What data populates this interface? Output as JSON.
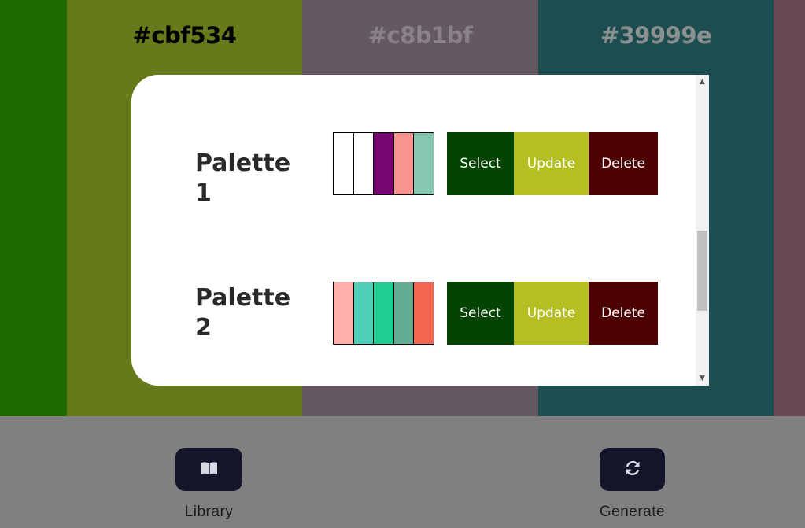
{
  "columns": [
    {
      "color": "#1e6800",
      "hex": "",
      "text_color": "#000000"
    },
    {
      "color": "#667a1b",
      "hex": "#cbf534",
      "text_color": "#000000"
    },
    {
      "color": "#645861",
      "hex": "#c8b1bf",
      "text_color": "#8a8289"
    },
    {
      "color": "#1d4d50",
      "hex": "#39999e",
      "text_color": "#8a8f8f"
    },
    {
      "color": "#674a53",
      "hex": "",
      "text_color": "#000000"
    }
  ],
  "modal": {
    "palettes": [
      {
        "name": "Palette 1",
        "swatches": [
          "#ffffff",
          "#ffffff",
          "#76066f",
          "#f8938e",
          "#85c7b1"
        ],
        "select_label": "Select",
        "update_label": "Update",
        "delete_label": "Delete"
      },
      {
        "name": "Palette 2",
        "swatches": [
          "#ffafaa",
          "#4ecfb8",
          "#1fcc91",
          "#63ad93",
          "#f56751"
        ],
        "select_label": "Select",
        "update_label": "Update",
        "delete_label": "Delete"
      }
    ],
    "colors": {
      "select": "#034400",
      "update": "#b5bf21",
      "delete": "#4d0000"
    }
  },
  "toolbar": {
    "library_label": "Library",
    "library_icon": "book-open-icon",
    "generate_label": "Generate",
    "generate_icon": "refresh-icon"
  }
}
